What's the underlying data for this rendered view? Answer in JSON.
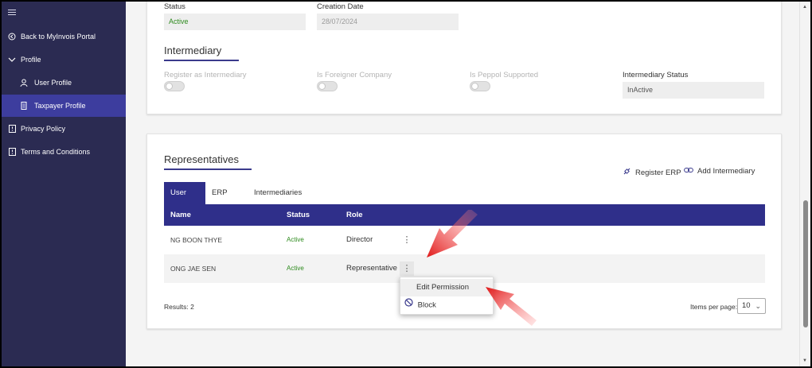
{
  "sidebar": {
    "items": [
      {
        "label": "Back to MyInvois Portal",
        "icon": "back-circle-icon"
      },
      {
        "label": "Profile",
        "icon": "chevron-down-icon"
      },
      {
        "label": "User Profile",
        "icon": "user-icon"
      },
      {
        "label": "Taxpayer Profile",
        "icon": "building-icon"
      },
      {
        "label": "Privacy Policy",
        "icon": "document-icon"
      },
      {
        "label": "Terms and Conditions",
        "icon": "document-icon"
      }
    ],
    "active_item": "Taxpayer Profile"
  },
  "profile": {
    "status_label": "Status",
    "status_value": "Active",
    "creation_date_label": "Creation Date",
    "creation_date_value": "28/07/2024"
  },
  "intermediary": {
    "title": "Intermediary",
    "register_label": "Register as Intermediary",
    "foreigner_label": "Is Foreigner Company",
    "peppol_label": "Is Peppol Supported",
    "status_label": "Intermediary Status",
    "status_value": "InActive"
  },
  "representatives": {
    "title": "Representatives",
    "register_erp": "Register ERP",
    "add_intermediary": "Add Intermediary",
    "tabs": [
      "User",
      "ERP",
      "Intermediaries"
    ],
    "columns": [
      "Name",
      "Status",
      "Role"
    ],
    "rows": [
      {
        "name": "NG BOON THYE",
        "status": "Active",
        "role": "Director"
      },
      {
        "name": "ONG JAE SEN",
        "status": "Active",
        "role": "Representative"
      }
    ],
    "menu": [
      "Edit Permission",
      "Block"
    ],
    "results": "Results: 2",
    "items_per_page_label": "Items per page:",
    "items_per_page_value": "10"
  },
  "colors": {
    "sidebar": "#2b2b52",
    "accent": "#2f2f8a",
    "active_green": "#2e8b1e",
    "annotation_arrow": "#e02020"
  }
}
